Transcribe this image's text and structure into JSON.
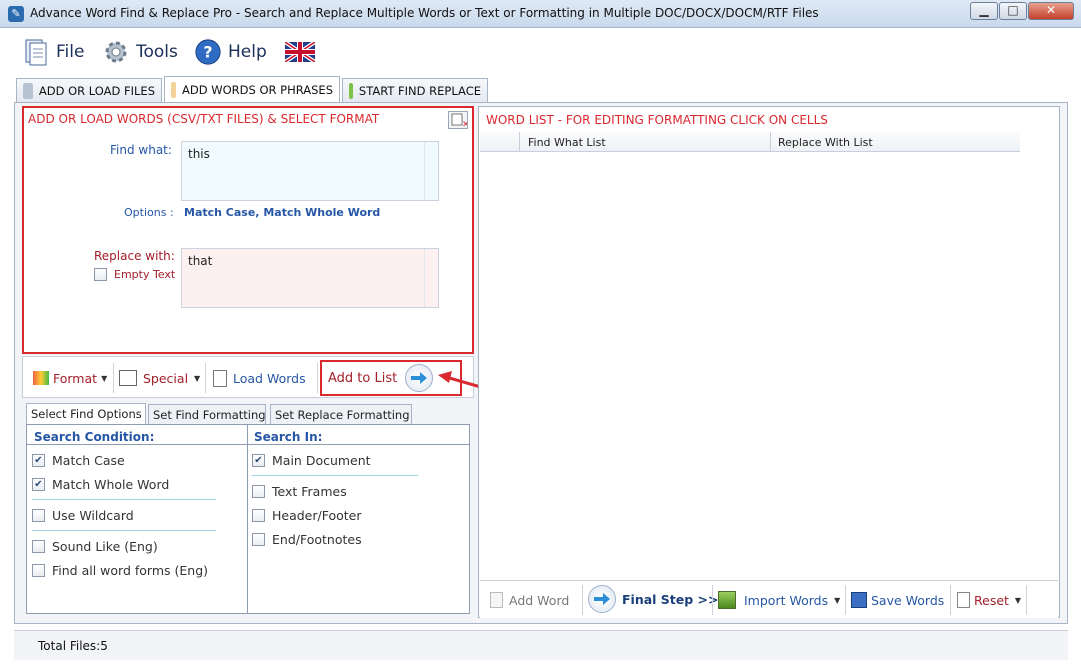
{
  "window": {
    "title": "Advance Word Find & Replace Pro - Search and Replace Multiple Words or Text  or Formatting in Multiple DOC/DOCX/DOCM/RTF Files",
    "minimize_label": "▁",
    "maximize_label": "□",
    "close_label": "✕"
  },
  "menu": {
    "file": "File",
    "tools": "Tools",
    "help": "Help"
  },
  "tabs": [
    {
      "label": "ADD OR LOAD FILES"
    },
    {
      "label": "ADD WORDS OR PHRASES"
    },
    {
      "label": "START FIND REPLACE"
    }
  ],
  "add_panel": {
    "title": "ADD OR LOAD WORDS (CSV/TXT FILES) & SELECT FORMAT",
    "find_label": "Find what:",
    "find_value": "this",
    "options_label": "Options :",
    "options_value": "Match Case, Match Whole Word",
    "replace_label": "Replace with:",
    "replace_value": "that",
    "empty_text_label": "Empty Text"
  },
  "toolbar": {
    "format": "Format",
    "special": "Special",
    "load_words": "Load Words",
    "add_to_list": "Add to List"
  },
  "option_tabs": [
    {
      "label": "Select Find Options"
    },
    {
      "label": "Set Find Formatting"
    },
    {
      "label": "Set Replace Formatting"
    }
  ],
  "search_condition": {
    "header": "Search Condition:",
    "items": [
      {
        "label": "Match Case",
        "checked": true
      },
      {
        "label": "Match Whole Word",
        "checked": true
      },
      {
        "label": "Use Wildcard",
        "checked": false
      },
      {
        "label": "Sound Like (Eng)",
        "checked": false
      },
      {
        "label": "Find all word forms (Eng)",
        "checked": false
      }
    ]
  },
  "search_in": {
    "header": "Search In:",
    "items": [
      {
        "label": "Main Document",
        "checked": true
      },
      {
        "label": "Text Frames",
        "checked": false
      },
      {
        "label": "Header/Footer",
        "checked": false
      },
      {
        "label": "End/Footnotes",
        "checked": false
      }
    ]
  },
  "word_list": {
    "title": "WORD LIST - FOR EDITING FORMATTING CLICK ON CELLS",
    "col_find": "Find What List",
    "col_replace": "Replace With List"
  },
  "right_toolbar": {
    "add_word": "Add Word",
    "final_step": "Final Step >>",
    "import_words": "Import Words",
    "save_words": "Save Words",
    "reset": "Reset"
  },
  "status": {
    "total_files": "Total Files:5"
  },
  "colors": {
    "accent_red": "#d9292e",
    "link_blue": "#2657a6"
  }
}
